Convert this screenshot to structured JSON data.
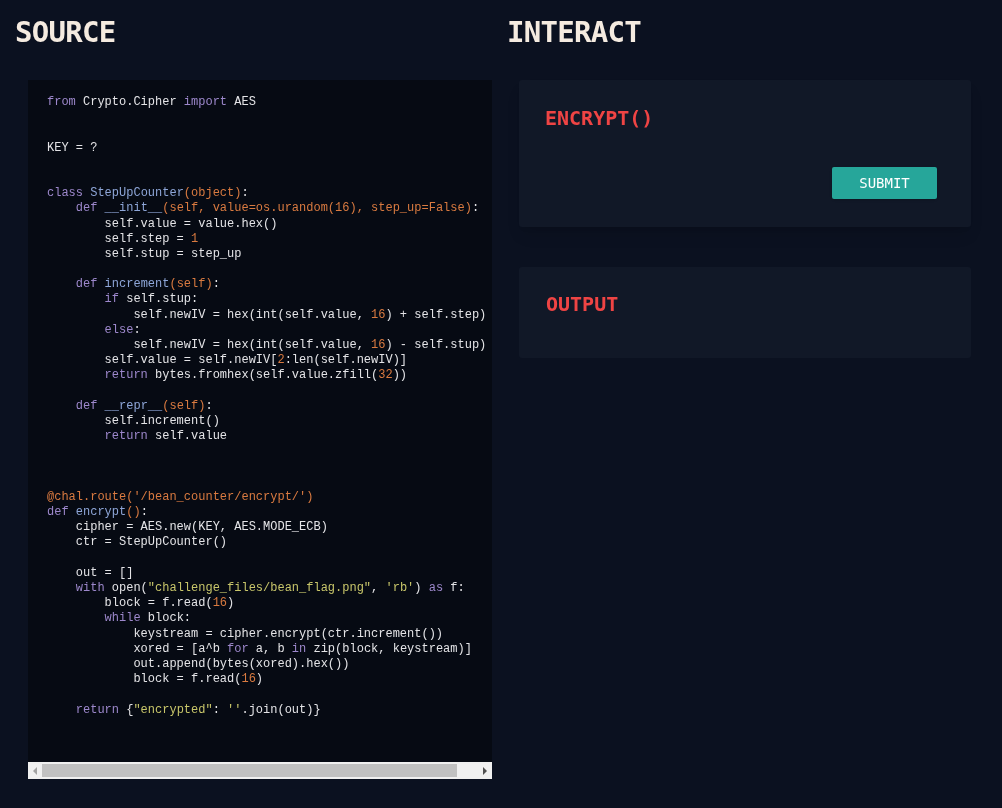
{
  "source": {
    "heading": "SOURCE",
    "lines": [
      {
        "kind": "code",
        "segments": [
          {
            "kind": "kw",
            "text": "from"
          },
          {
            "kind": "plain",
            "text": " Crypto.Cipher "
          },
          {
            "kind": "kw",
            "text": "import"
          },
          {
            "kind": "plain",
            "text": " AES"
          }
        ]
      },
      {
        "kind": "blank"
      },
      {
        "kind": "blank"
      },
      {
        "kind": "code",
        "segments": [
          {
            "kind": "plain",
            "text": "KEY = ?"
          }
        ]
      },
      {
        "kind": "blank"
      },
      {
        "kind": "blank"
      },
      {
        "kind": "code",
        "segments": [
          {
            "kind": "kw",
            "text": "class"
          },
          {
            "kind": "name",
            "text": " StepUpCounter"
          },
          {
            "kind": "accent",
            "text": "(object)"
          },
          {
            "kind": "plain",
            "text": ":"
          }
        ]
      },
      {
        "kind": "code",
        "segments": [
          {
            "kind": "kw",
            "text": "    def"
          },
          {
            "kind": "name",
            "text": " __init__"
          },
          {
            "kind": "accent",
            "text": "(self, value=os.urandom(16), step_up=False)"
          },
          {
            "kind": "plain",
            "text": ":"
          }
        ]
      },
      {
        "kind": "code",
        "segments": [
          {
            "kind": "plain",
            "text": "        self.value = value.hex()"
          }
        ]
      },
      {
        "kind": "code",
        "segments": [
          {
            "kind": "plain",
            "text": "        self.step = "
          },
          {
            "kind": "accent",
            "text": "1"
          }
        ]
      },
      {
        "kind": "code",
        "segments": [
          {
            "kind": "plain",
            "text": "        self.stup = step_up"
          }
        ]
      },
      {
        "kind": "blank"
      },
      {
        "kind": "code",
        "segments": [
          {
            "kind": "kw",
            "text": "    def"
          },
          {
            "kind": "name",
            "text": " increment"
          },
          {
            "kind": "accent",
            "text": "(self)"
          },
          {
            "kind": "plain",
            "text": ":"
          }
        ]
      },
      {
        "kind": "code",
        "segments": [
          {
            "kind": "kw",
            "text": "        if"
          },
          {
            "kind": "plain",
            "text": " self.stup:"
          }
        ]
      },
      {
        "kind": "code",
        "segments": [
          {
            "kind": "plain",
            "text": "            self.newIV = hex(int(self.value, "
          },
          {
            "kind": "accent",
            "text": "16"
          },
          {
            "kind": "plain",
            "text": ") + self.step)"
          }
        ]
      },
      {
        "kind": "code",
        "segments": [
          {
            "kind": "kw",
            "text": "        else"
          },
          {
            "kind": "plain",
            "text": ":"
          }
        ]
      },
      {
        "kind": "code",
        "segments": [
          {
            "kind": "plain",
            "text": "            self.newIV = hex(int(self.value, "
          },
          {
            "kind": "accent",
            "text": "16"
          },
          {
            "kind": "plain",
            "text": ") - self.stup)"
          }
        ]
      },
      {
        "kind": "code",
        "segments": [
          {
            "kind": "plain",
            "text": "        self.value = self.newIV["
          },
          {
            "kind": "accent",
            "text": "2"
          },
          {
            "kind": "plain",
            "text": ":len(self.newIV)]"
          }
        ]
      },
      {
        "kind": "code",
        "segments": [
          {
            "kind": "kw",
            "text": "        return"
          },
          {
            "kind": "plain",
            "text": " bytes.fromhex(self.value.zfill("
          },
          {
            "kind": "accent",
            "text": "32"
          },
          {
            "kind": "plain",
            "text": "))"
          }
        ]
      },
      {
        "kind": "blank"
      },
      {
        "kind": "code",
        "segments": [
          {
            "kind": "kw",
            "text": "    def"
          },
          {
            "kind": "name",
            "text": " __repr__"
          },
          {
            "kind": "accent",
            "text": "(self)"
          },
          {
            "kind": "plain",
            "text": ":"
          }
        ]
      },
      {
        "kind": "code",
        "segments": [
          {
            "kind": "plain",
            "text": "        self.increment()"
          }
        ]
      },
      {
        "kind": "code",
        "segments": [
          {
            "kind": "kw",
            "text": "        return"
          },
          {
            "kind": "plain",
            "text": " self.value"
          }
        ]
      },
      {
        "kind": "blank"
      },
      {
        "kind": "blank"
      },
      {
        "kind": "blank"
      },
      {
        "kind": "code",
        "segments": [
          {
            "kind": "accent",
            "text": "@chal.route('/bean_counter/encrypt/')"
          }
        ]
      },
      {
        "kind": "code",
        "segments": [
          {
            "kind": "kw",
            "text": "def"
          },
          {
            "kind": "name",
            "text": " encrypt"
          },
          {
            "kind": "accent",
            "text": "()"
          },
          {
            "kind": "plain",
            "text": ":"
          }
        ]
      },
      {
        "kind": "code",
        "segments": [
          {
            "kind": "plain",
            "text": "    cipher = AES.new(KEY, AES.MODE_ECB)"
          }
        ]
      },
      {
        "kind": "code",
        "segments": [
          {
            "kind": "plain",
            "text": "    ctr = StepUpCounter()"
          }
        ]
      },
      {
        "kind": "blank"
      },
      {
        "kind": "code",
        "segments": [
          {
            "kind": "plain",
            "text": "    out = []"
          }
        ]
      },
      {
        "kind": "code",
        "segments": [
          {
            "kind": "kw",
            "text": "    with"
          },
          {
            "kind": "plain",
            "text": " open("
          },
          {
            "kind": "str",
            "text": "\"challenge_files/bean_flag.png\""
          },
          {
            "kind": "plain",
            "text": ", "
          },
          {
            "kind": "str",
            "text": "'rb'"
          },
          {
            "kind": "plain",
            "text": ") "
          },
          {
            "kind": "kw",
            "text": "as"
          },
          {
            "kind": "plain",
            "text": " f:"
          }
        ]
      },
      {
        "kind": "code",
        "segments": [
          {
            "kind": "plain",
            "text": "        block = f.read("
          },
          {
            "kind": "accent",
            "text": "16"
          },
          {
            "kind": "plain",
            "text": ")"
          }
        ]
      },
      {
        "kind": "code",
        "segments": [
          {
            "kind": "kw",
            "text": "        while"
          },
          {
            "kind": "plain",
            "text": " block:"
          }
        ]
      },
      {
        "kind": "code",
        "segments": [
          {
            "kind": "plain",
            "text": "            keystream = cipher.encrypt(ctr.increment())"
          }
        ]
      },
      {
        "kind": "code",
        "segments": [
          {
            "kind": "plain",
            "text": "            xored = [a^b "
          },
          {
            "kind": "kw",
            "text": "for"
          },
          {
            "kind": "plain",
            "text": " a, b "
          },
          {
            "kind": "kw",
            "text": "in"
          },
          {
            "kind": "plain",
            "text": " zip(block, keystream)]"
          }
        ]
      },
      {
        "kind": "code",
        "segments": [
          {
            "kind": "plain",
            "text": "            out.append(bytes(xored).hex())"
          }
        ]
      },
      {
        "kind": "code",
        "segments": [
          {
            "kind": "plain",
            "text": "            block = f.read("
          },
          {
            "kind": "accent",
            "text": "16"
          },
          {
            "kind": "plain",
            "text": ")"
          }
        ]
      },
      {
        "kind": "blank"
      },
      {
        "kind": "code",
        "segments": [
          {
            "kind": "kw",
            "text": "    return"
          },
          {
            "kind": "plain",
            "text": " {"
          },
          {
            "kind": "str",
            "text": "\"encrypted\""
          },
          {
            "kind": "plain",
            "text": ": "
          },
          {
            "kind": "str",
            "text": "''"
          },
          {
            "kind": "plain",
            "text": ".join(out)}"
          }
        ]
      }
    ]
  },
  "interact": {
    "heading": "INTERACT",
    "encrypt_card": {
      "title": "ENCRYPT()",
      "button": "SUBMIT"
    },
    "output_card": {
      "title": "OUTPUT"
    }
  }
}
